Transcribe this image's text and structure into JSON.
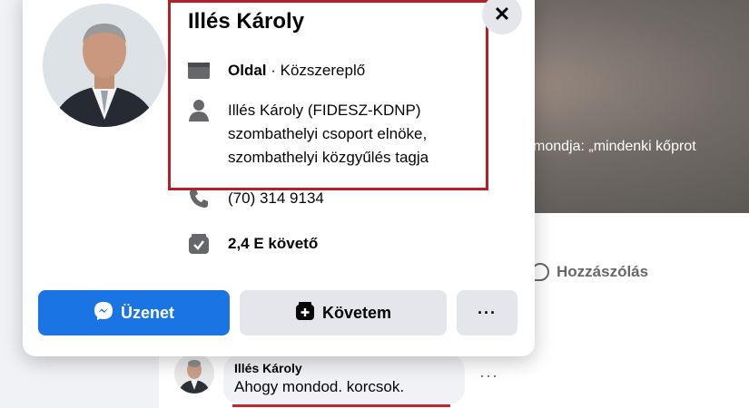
{
  "background": {
    "photo_caption": "mondja: „mindenki kőprot",
    "comment_button_label": "Hozzászólás",
    "comment": {
      "author": "Illés Károly",
      "text": "Ahogy mondod. korcsok.",
      "more_label": "···"
    }
  },
  "card": {
    "name": "Illés Károly",
    "close_label": "✕",
    "page_type_bold": "Oldal",
    "page_type_rest": " · Közszereplő",
    "bio_lines": [
      "Illés Károly (FIDESZ-KDNP)",
      "szombathelyi csoport elnöke,",
      "szombathelyi közgyűlés tagja"
    ],
    "phone": "(70) 314 9134",
    "followers": "2,4 E követő",
    "buttons": {
      "message": "Üzenet",
      "follow": "Követem",
      "more": "···"
    }
  },
  "colors": {
    "accent": "#1b74e4",
    "highlight": "#b32025"
  }
}
